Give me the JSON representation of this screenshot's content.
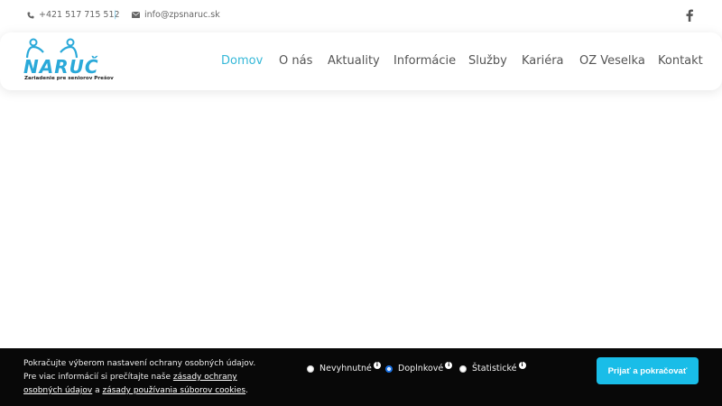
{
  "topbar": {
    "phone": "+421 517 715 512",
    "separator": "|",
    "email": "info@zpsnaruc.sk"
  },
  "logo": {
    "name": "NARUČ",
    "subtitle": "Zariadenie pre seniorov Prešov"
  },
  "nav": {
    "items": [
      {
        "label": "Domov",
        "active": true
      },
      {
        "label": "O nás"
      },
      {
        "label": "Aktuality"
      },
      {
        "label": "Informácie"
      },
      {
        "label": "Služby"
      },
      {
        "label": "Kariéra"
      },
      {
        "label": "OZ Veselka"
      },
      {
        "label": "Kontakt"
      }
    ]
  },
  "cookie": {
    "text_1": "Pokračujte výberom nastavení ochrany osobných údajov. Pre viac informácií si prečítajte naše ",
    "link_1": "zásady ochrany osobných údajov",
    "text_2": " a ",
    "link_2": "zásady používania súborov cookies",
    "text_3": ".",
    "options": [
      {
        "label": "Nevyhnutné",
        "checked": false
      },
      {
        "label": "Doplnkové",
        "checked": true
      },
      {
        "label": "Štatistické",
        "checked": false
      }
    ],
    "info_glyph": "i",
    "accept_label": "Prijať a pokračovať"
  },
  "colors": {
    "accent": "#35b8d8",
    "button": "#19bde8",
    "cookie_bg": "#080808"
  },
  "icons": {
    "phone": "phone-icon",
    "email": "envelope-icon",
    "social": "facebook-icon"
  }
}
